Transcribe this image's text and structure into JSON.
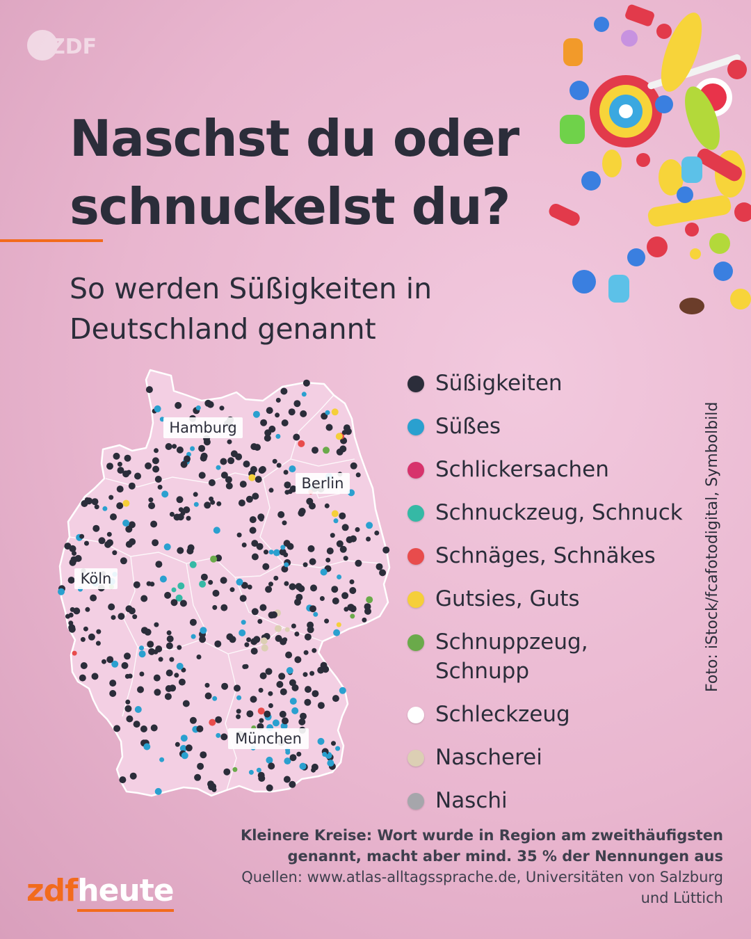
{
  "header": {
    "zdf_logo": "ZDF",
    "title": "Naschst du oder schnuckelst du?",
    "subtitle": "So werden Süßigkeiten in Deutschland genannt",
    "photo_credit": "Foto: iStock/fcafotodigital, Symbolbild"
  },
  "map": {
    "cities": [
      "Hamburg",
      "Berlin",
      "Köln",
      "München"
    ]
  },
  "legend": [
    {
      "label": "Süßigkeiten",
      "color": "#2b2d3a"
    },
    {
      "label": "Süßes",
      "color": "#2aa0cf"
    },
    {
      "label": "Schlickersachen",
      "color": "#d7336c"
    },
    {
      "label": "Schnuckzeug, Schnuck",
      "color": "#35b9a5"
    },
    {
      "label": "Schnäges, Schnäkes",
      "color": "#e84c4c"
    },
    {
      "label": "Gutsies, Guts",
      "color": "#f5cf3a"
    },
    {
      "label": "Schnuppzeug, Schnupp",
      "color": "#6aaa4a"
    },
    {
      "label": "Schleckzeug",
      "color": "#ffffff"
    },
    {
      "label": "Nascherei",
      "color": "#dccfb4"
    },
    {
      "label": "Naschi",
      "color": "#a6a6ab"
    }
  ],
  "footer": {
    "note": "Kleinere Kreise: Wort wurde in Region am zweithäufigsten genannt, macht aber mind. 35 % der Nennungen aus",
    "sources": "Quellen: www.atlas-alltagssprache.de, Universitäten von Salzburg und Lüttich",
    "brand_zdf": "zdf",
    "brand_heute": "heute"
  }
}
